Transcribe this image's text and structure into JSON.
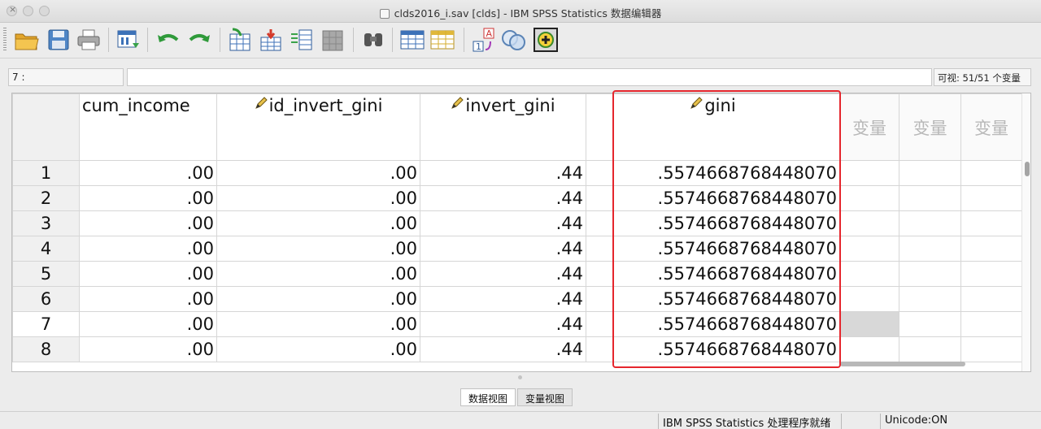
{
  "window": {
    "title": "clds2016_i.sav [clds] - IBM SPSS Statistics 数据编辑器"
  },
  "toolbar": {
    "buttons": [
      {
        "name": "open-data-icon"
      },
      {
        "name": "save-icon"
      },
      {
        "name": "print-icon"
      },
      {
        "name": "recall-dialog-icon"
      },
      {
        "name": "undo-icon"
      },
      {
        "name": "redo-icon"
      },
      {
        "name": "goto-case-icon"
      },
      {
        "name": "goto-variable-icon"
      },
      {
        "name": "variables-icon"
      },
      {
        "name": "run-descriptives-icon"
      },
      {
        "name": "find-icon"
      },
      {
        "name": "insert-cases-icon"
      },
      {
        "name": "insert-variable-icon"
      },
      {
        "name": "split-file-icon"
      },
      {
        "name": "weight-cases-icon"
      },
      {
        "name": "select-cases-icon"
      },
      {
        "name": "value-labels-icon"
      },
      {
        "name": "use-sets-icon"
      }
    ]
  },
  "editor": {
    "cell_ref": "7 :",
    "visible_count": "可视: 51/51 个变量"
  },
  "grid": {
    "columns": [
      {
        "name": "cum_income",
        "has_icon": false
      },
      {
        "name": "id_invert_gini",
        "has_icon": true
      },
      {
        "name": "invert_gini",
        "has_icon": true
      },
      {
        "name": "gini",
        "has_icon": true
      }
    ],
    "empty_column_label": "变量",
    "rows": [
      {
        "n": "1",
        "cells": [
          ".00",
          ".00",
          ".44",
          ".5574668768448070"
        ]
      },
      {
        "n": "2",
        "cells": [
          ".00",
          ".00",
          ".44",
          ".5574668768448070"
        ]
      },
      {
        "n": "3",
        "cells": [
          ".00",
          ".00",
          ".44",
          ".5574668768448070"
        ]
      },
      {
        "n": "4",
        "cells": [
          ".00",
          ".00",
          ".44",
          ".5574668768448070"
        ]
      },
      {
        "n": "5",
        "cells": [
          ".00",
          ".00",
          ".44",
          ".5574668768448070"
        ]
      },
      {
        "n": "6",
        "cells": [
          ".00",
          ".00",
          ".44",
          ".5574668768448070"
        ]
      },
      {
        "n": "7",
        "cells": [
          ".00",
          ".00",
          ".44",
          ".5574668768448070"
        ]
      },
      {
        "n": "8",
        "cells": [
          ".00",
          ".00",
          ".44",
          ".5574668768448070"
        ]
      }
    ],
    "current_row": "7",
    "highlight_color": "#e5262d"
  },
  "tabs": {
    "data_view": "数据视图",
    "variable_view": "变量视图"
  },
  "status": {
    "processor": "IBM SPSS Statistics 处理程序就绪",
    "unicode": "Unicode:ON"
  }
}
